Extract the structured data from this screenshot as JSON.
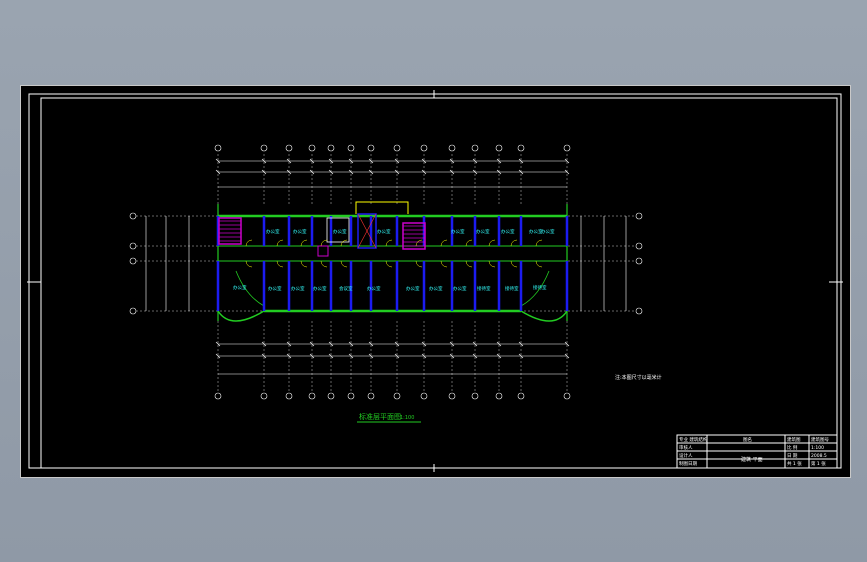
{
  "drawing": {
    "title": "标准层平面图",
    "title_scale": "1:100",
    "note": "注:本图尺寸以毫米计",
    "axes_top": [
      "1",
      "2",
      "3",
      "4",
      "5",
      "6",
      "7",
      "8",
      "9",
      "10",
      "11",
      "12",
      "13"
    ],
    "axes_side": [
      "A",
      "B",
      "C",
      "D"
    ],
    "rooms_upper": [
      "办公室",
      "办公室",
      "办公室",
      "办公室",
      "办公室",
      "办公室",
      "办公室",
      "办公室",
      "办公室"
    ],
    "rooms_lower": [
      "办公室",
      "办公室",
      "办公室",
      "会议室",
      "办公室",
      "办公室",
      "办公室",
      "办公室",
      "接待室",
      "接待室"
    ],
    "wing_left": "办公室",
    "wing_right": "接待室"
  },
  "title_block": {
    "r1": [
      "专业 建筑结构",
      "图名",
      "建筑图",
      "建筑图号"
    ],
    "r2": [
      "审核人",
      "",
      "比 例",
      "1:100"
    ],
    "r3": [
      "设计人",
      "",
      "日 期",
      "2008.5"
    ],
    "r4": [
      "制图日期",
      "",
      "共 1 张",
      "第 1 张"
    ],
    "center_label": "建筑 平面"
  },
  "colors": {
    "wall": "#1c1cf0",
    "green": "#22cc22",
    "axis": "#ffffff",
    "text": "#33ffff",
    "stair": "#cc00cc",
    "door": "#ffff00"
  }
}
